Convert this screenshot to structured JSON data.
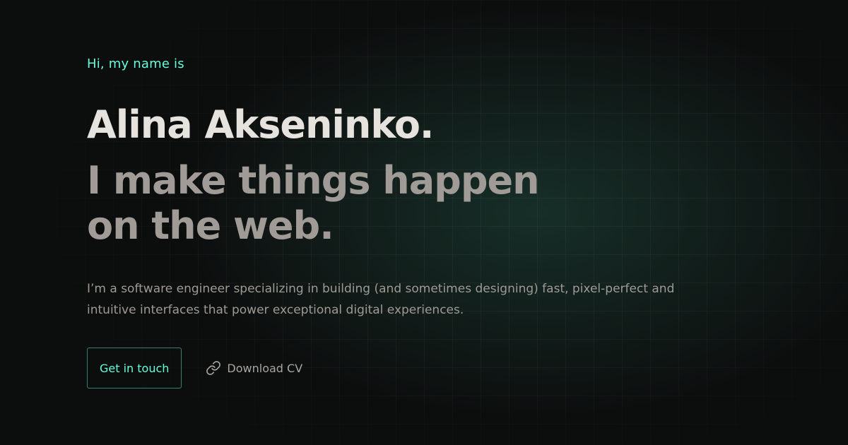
{
  "hero": {
    "intro": "Hi, my name is",
    "name": "Alina Akseninko.",
    "tagline": "I make things happen on the web.",
    "description": "I’m a software engineer specializing in building (and sometimes designing) fast, pixel-perfect and intuitive interfaces that power exceptional digital experiences."
  },
  "actions": {
    "primary_label": "Get in touch",
    "secondary_label": "Download CV",
    "secondary_icon": "link-icon"
  },
  "colors": {
    "accent": "#64ffda",
    "background": "#0c0d0d",
    "heading": "#e6e3df",
    "tagline": "#a09b97",
    "body_text": "#9e9a96"
  }
}
